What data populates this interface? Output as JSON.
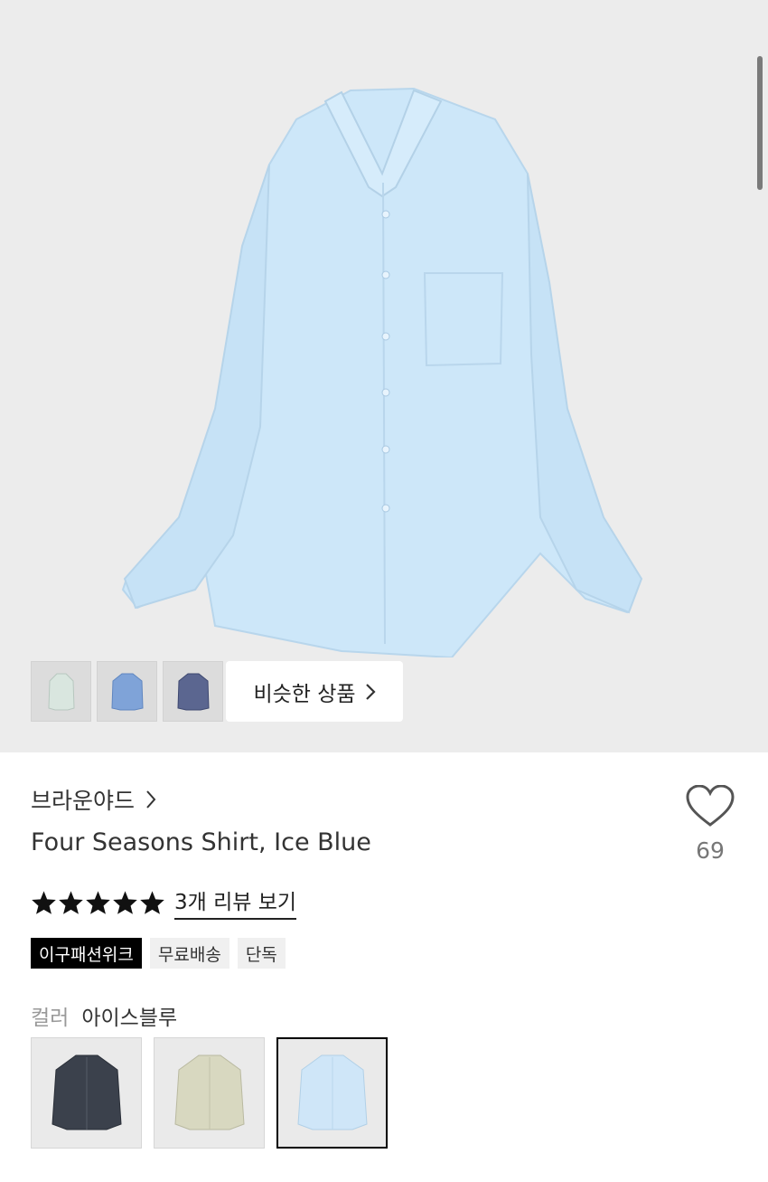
{
  "product": {
    "brand": "브라운야드",
    "title": "Four Seasons Shirt, Ice Blue",
    "like_count": "69",
    "review_link": "3개 리뷰 보기",
    "rating_stars": 5,
    "similar_button": "비슷한 상품"
  },
  "tags": [
    "이구패션위크",
    "무료배송",
    "단독"
  ],
  "color": {
    "label": "컬러",
    "value": "아이스블루"
  },
  "thumbnails": [
    {
      "name": "mint-shirt",
      "color": "#d9e6df"
    },
    {
      "name": "blue-shirt",
      "color": "#7fa3d8"
    },
    {
      "name": "navy-stripe-shirt",
      "color": "#5b6690"
    }
  ],
  "swatches": [
    {
      "name": "charcoal",
      "color": "#3b414c",
      "selected": false
    },
    {
      "name": "beige",
      "color": "#d8d8c0",
      "selected": false
    },
    {
      "name": "ice-blue",
      "color": "#cfe6f8",
      "selected": true
    }
  ],
  "colors": {
    "hero_bg": "#ececec",
    "shirt": "#cde7f9",
    "text": "#222222"
  }
}
